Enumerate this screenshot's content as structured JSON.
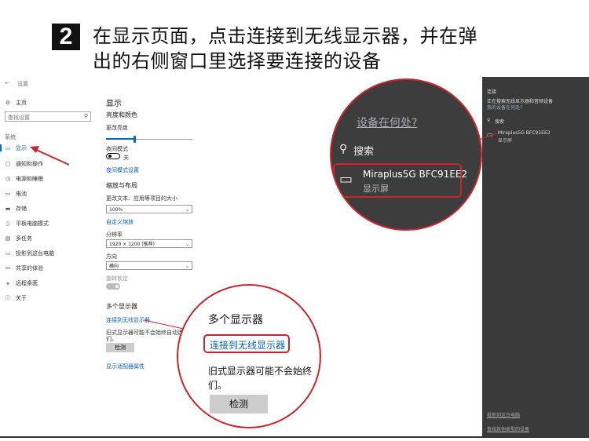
{
  "instruction": {
    "step_number": "2",
    "line1": "在显示页面，点击连接到无线显示器，并在弹",
    "line2": "出的右侧窗口里选择要连接的设备"
  },
  "settings": {
    "back_glyph": "←",
    "window_title": "设置",
    "home": "主页",
    "search_placeholder": "查找设置",
    "section_label": "系统",
    "nav": [
      {
        "icon": "display-icon",
        "glyph": "▭",
        "label": "显示"
      },
      {
        "icon": "notification-icon",
        "glyph": "▢",
        "label": "通知和操作"
      },
      {
        "icon": "power-icon",
        "glyph": "◷",
        "label": "电源和睡眠"
      },
      {
        "icon": "battery-icon",
        "glyph": "▭",
        "label": "电池"
      },
      {
        "icon": "storage-icon",
        "glyph": "▬",
        "label": "存储"
      },
      {
        "icon": "tablet-icon",
        "glyph": "▯",
        "label": "平板电脑模式"
      },
      {
        "icon": "multitask-icon",
        "glyph": "▤",
        "label": "多任务"
      },
      {
        "icon": "project-icon",
        "glyph": "▭",
        "label": "投影到这台电脑"
      },
      {
        "icon": "shared-icon",
        "glyph": "⚯",
        "label": "共享的体验"
      },
      {
        "icon": "remote-icon",
        "glyph": "⚹",
        "label": "远程桌面"
      },
      {
        "icon": "about-icon",
        "glyph": "ⓘ",
        "label": "关于"
      }
    ],
    "page_title": "显示",
    "brightness_heading": "亮度和颜色",
    "brightness_label": "更改亮度",
    "brightness_value": 0.33,
    "night_light_label": "夜间模式",
    "night_light_state": "关",
    "night_light_link": "夜间模式设置",
    "scale_heading": "缩放与布局",
    "scale_label": "更改文本、应用等项目的大小",
    "scale_value": "100%",
    "custom_scale_link": "自定义缩放",
    "resolution_label": "分辨率",
    "resolution_value": "1920 × 1200 (推荐)",
    "orientation_label": "方向",
    "orientation_value": "横向",
    "rotation_lock_label": "旋转锁定",
    "multi_display_heading": "多个显示器",
    "connect_wireless_link": "连接到无线显示器",
    "legacy_text_1": "旧式显示器可能不会始终自动连接。",
    "legacy_text_2": "们。",
    "detect_button": "检测",
    "adapter_link": "显示适配器属性"
  },
  "connect_panel": {
    "title": "连接",
    "searching": "正在搜索无线显示器和音频设备",
    "where_link": "我的设备在何处?",
    "search_label": "搜索",
    "device_name": "Miraplus5G BFC91EE2",
    "device_type": "显示屏",
    "footer_link_1": "投影到这台电脑",
    "footer_link_2": "查找其他类型的设备"
  },
  "zoom_top": {
    "where_link": "设备在何处?",
    "search_label": "搜索",
    "device_name": "Miraplus5G BFC91EE2",
    "device_type": "显示屏"
  },
  "zoom_bottom": {
    "heading": "多个显示器",
    "connect_wireless_link": "连接到无线显示器",
    "legacy_text_1": "旧式显示器可能不会始终",
    "legacy_text_2": "们。",
    "detect_button": "检测"
  },
  "colors": {
    "highlight_red": "#c9252c",
    "link_blue": "#0b63c5",
    "panel_bg": "#3a3a3a"
  }
}
